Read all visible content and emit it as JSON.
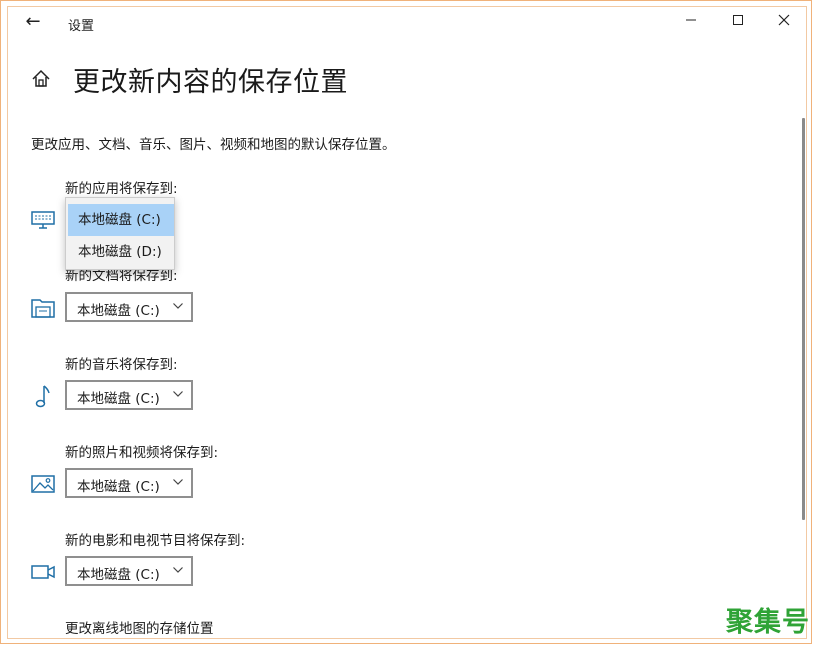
{
  "titlebar": {
    "back_glyph": "←",
    "app_title": "设置",
    "minimize_glyph": "—",
    "maximize_glyph": "☐",
    "close_glyph": "✕"
  },
  "header": {
    "title": "更改新内容的保存位置"
  },
  "description": "更改应用、文档、音乐、图片、视频和地图的默认保存位置。",
  "sections": [
    {
      "label": "新的应用将保存到:",
      "value": "本地磁盘 (C:)",
      "icon": "monitor-icon"
    },
    {
      "label": "新的文档将保存到:",
      "value": "本地磁盘 (C:)",
      "icon": "folder-icon"
    },
    {
      "label": "新的音乐将保存到:",
      "value": "本地磁盘 (C:)",
      "icon": "music-note-icon"
    },
    {
      "label": "新的照片和视频将保存到:",
      "value": "本地磁盘 (C:)",
      "icon": "picture-icon"
    },
    {
      "label": "新的电影和电视节目将保存到:",
      "value": "本地磁盘 (C:)",
      "icon": "video-camera-icon"
    }
  ],
  "popup": {
    "options": [
      "本地磁盘 (C:)",
      "本地磁盘 (D:)"
    ],
    "selected": "本地磁盘 (C:)"
  },
  "offline_maps_label": "更改离线地图的存储位置",
  "watermark": "聚集号",
  "colors": {
    "accent_icon": "#1f6fa6",
    "selected_option": "#a9d2f7",
    "watermark": "#2fa336",
    "frame": "#f0b27a"
  }
}
